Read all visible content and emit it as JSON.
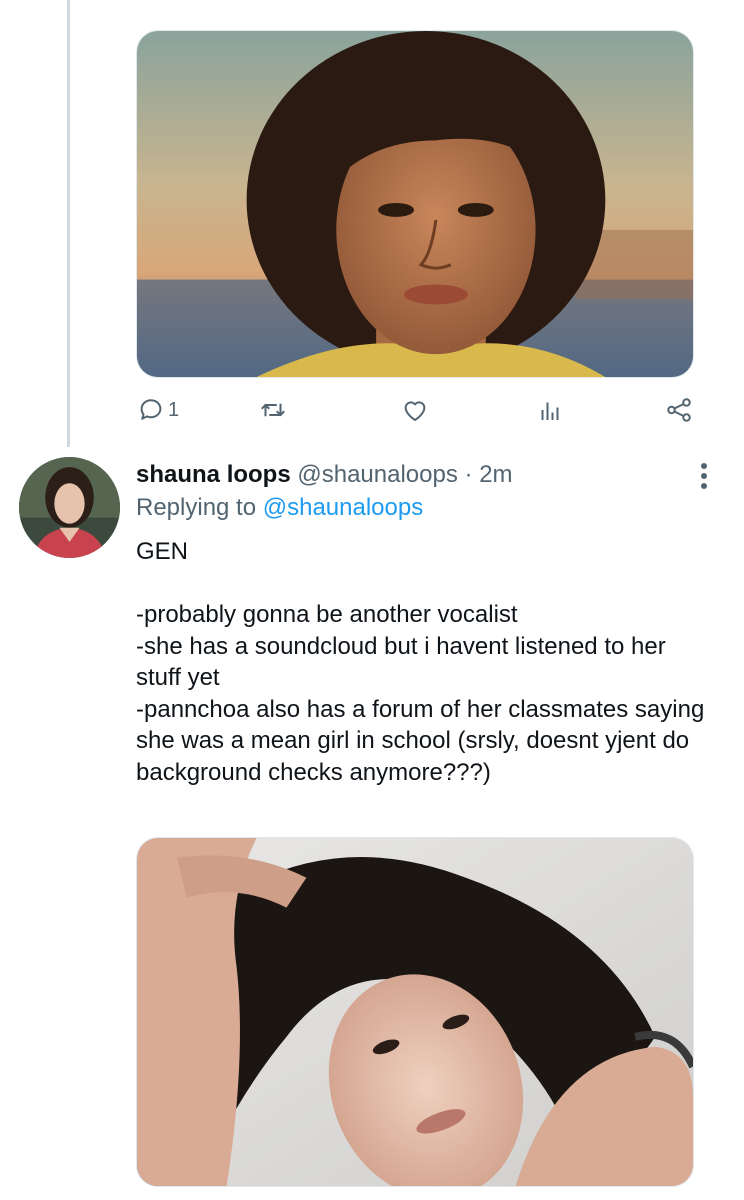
{
  "first_tweet": {
    "actions": {
      "reply_count": "1"
    }
  },
  "second_tweet": {
    "author": {
      "display_name": "shauna loops",
      "handle": "@shaunaloops",
      "separator": "·",
      "time": "2m"
    },
    "replying_prefix": "Replying to",
    "replying_to": "@shaunaloops",
    "text_heading": "GEN",
    "text_lines": [
      "-probably gonna be another vocalist",
      "-she has a soundcloud but i havent listened to her stuff yet",
      "-pannchoa also has a forum of her classmates saying she was a mean girl in school (srsly, doesnt yjent do background checks anymore???)"
    ]
  },
  "icons": {
    "reply": "reply-bubble-icon",
    "retweet": "retweet-arrows-icon",
    "like": "heart-icon",
    "analytics": "analytics-bars-icon",
    "share": "share-nodes-icon",
    "more": "vertical-dots-icon"
  },
  "colors": {
    "text_primary": "#0f1419",
    "text_secondary": "#536471",
    "link": "#1d9bf0",
    "thread_line": "#cfd9de"
  }
}
